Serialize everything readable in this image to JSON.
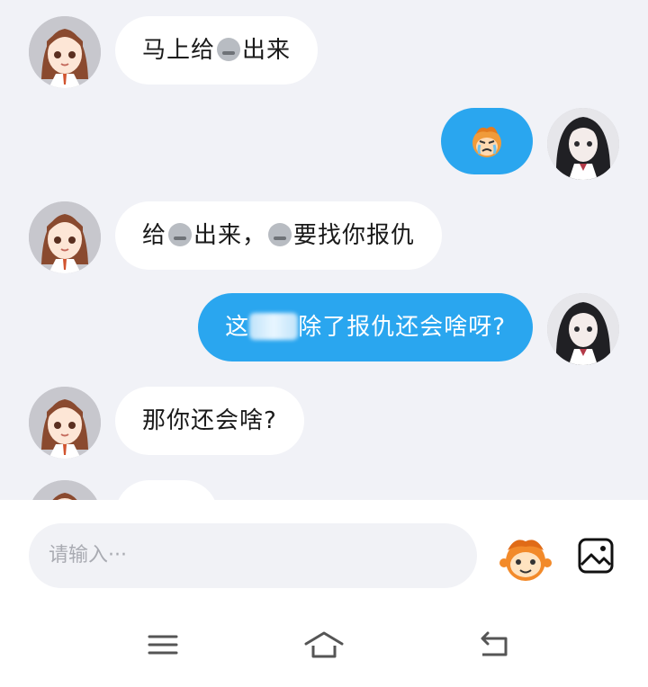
{
  "messages": [
    {
      "side": "left",
      "avatar": "girl-brown-hair-avatar",
      "pre": "马上给",
      "emoji": "gray-face-emoji",
      "post": "出来"
    },
    {
      "side": "right",
      "avatar": "girl-black-hair-avatar",
      "sticker": "orange-crying-monkey-sticker"
    },
    {
      "side": "left",
      "avatar": "girl-brown-hair-avatar",
      "pre": "给",
      "emoji": "gray-face-emoji",
      "mid": "出来，",
      "emoji2": "gray-face-emoji",
      "post": "要找你报仇"
    },
    {
      "side": "right",
      "avatar": "girl-black-hair-avatar",
      "pre": "这",
      "post": "除了报仇还会啥呀?"
    },
    {
      "side": "left",
      "avatar": "girl-brown-hair-avatar",
      "text": "那你还会啥?"
    }
  ],
  "input": {
    "placeholder": "请输入···"
  },
  "colors": {
    "bubble_right": "#2aa6ef",
    "bubble_left": "#ffffff",
    "background": "#f1f2f7"
  }
}
